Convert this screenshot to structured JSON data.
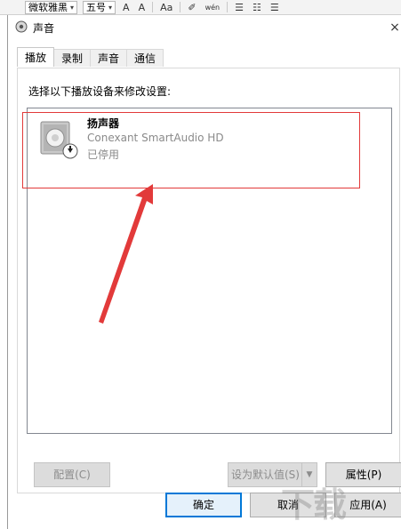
{
  "toolbar": {
    "font_name": "微软雅黑",
    "font_size": "五号",
    "grow_font": "A",
    "shrink_font": "A",
    "change_case": "Aa",
    "phonetic": "wén"
  },
  "dialog": {
    "title": "声音",
    "close_glyph": "×",
    "tabs": [
      {
        "label": "播放",
        "active": true
      },
      {
        "label": "录制",
        "active": false
      },
      {
        "label": "声音",
        "active": false
      },
      {
        "label": "通信",
        "active": false
      }
    ],
    "instructions": "选择以下播放设备来修改设置:",
    "device": {
      "name": "扬声器",
      "description": "Conexant SmartAudio HD",
      "status": "已停用"
    },
    "buttons": {
      "configure": "配置(C)",
      "set_default": "设为默认值(S)",
      "properties": "属性(P)",
      "ok": "确定",
      "cancel": "取消",
      "apply": "应用(A)"
    }
  },
  "annotation_color": "#e23a3a",
  "watermark_text": "下载"
}
